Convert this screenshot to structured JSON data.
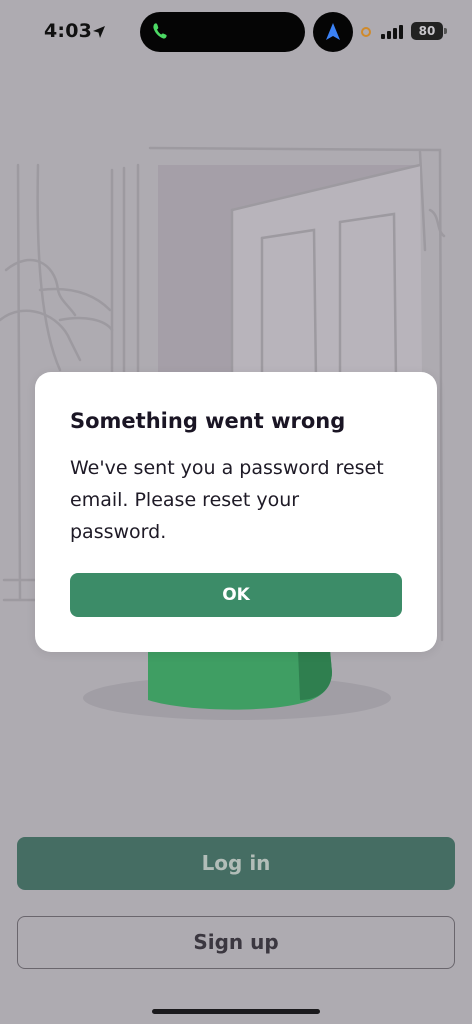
{
  "status_bar": {
    "time": "4:03",
    "battery": "80",
    "icons": [
      "location-arrow-icon",
      "phone-icon",
      "navigation-icon",
      "orange-indicator-dot",
      "cellular-signal-icon",
      "battery-icon"
    ]
  },
  "dialog": {
    "title": "Something went wrong",
    "message": "We've sent you a password reset email. Please reset your password.",
    "ok_label": "OK"
  },
  "actions": {
    "login_label": "Log in",
    "signup_label": "Sign up"
  },
  "colors": {
    "background_overlay": "#aeabb1",
    "primary_green": "#3c8c68",
    "login_dimmed": "#456d63",
    "dialog_bg": "#ffffff"
  }
}
